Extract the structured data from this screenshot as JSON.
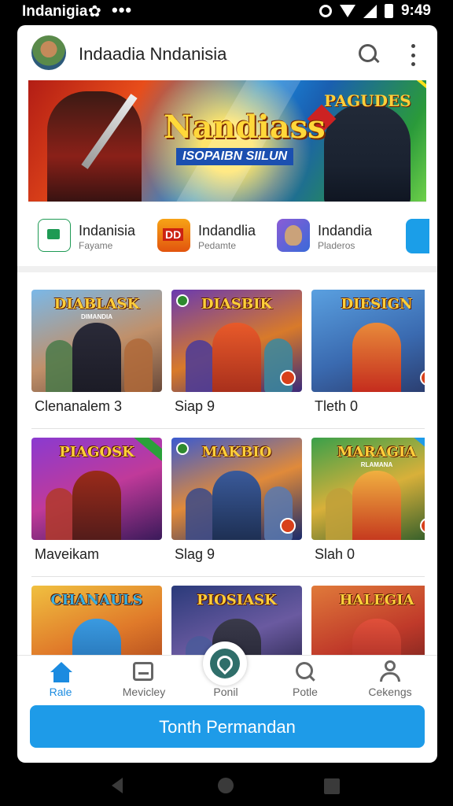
{
  "status_bar": {
    "title": "Indanigia",
    "time": "9:49"
  },
  "app_bar": {
    "title": "Indaadia Nndanisia"
  },
  "banner": {
    "headline": "Nandiass",
    "subtitle": "ISOPAIBN SIILUN",
    "right_logo": "PAGUDES"
  },
  "featured": [
    {
      "name": "Indanisia",
      "sub": "Fayame"
    },
    {
      "name": "Indandlia",
      "sub": "Pedamte"
    },
    {
      "name": "Indandia",
      "sub": "Pladeros"
    }
  ],
  "games": [
    {
      "caption": "Clenanalem 3",
      "logo": "DIABLASK",
      "tag": "DIMANDIA"
    },
    {
      "caption": "Siap 9",
      "logo": "DIASBIK",
      "tag": ""
    },
    {
      "caption": "Tleth 0",
      "logo": "DIESIGN",
      "tag": ""
    },
    {
      "caption": "Maveikam",
      "logo": "PIAGOSK",
      "tag": ""
    },
    {
      "caption": "Slag 9",
      "logo": "MAKBIO",
      "tag": ""
    },
    {
      "caption": "Slah 0",
      "logo": "MARAGIA",
      "tag": "RLAMANA"
    },
    {
      "caption": "",
      "logo": "CHANAULS",
      "tag": ""
    },
    {
      "caption": "",
      "logo": "PIOSIASK",
      "tag": ""
    },
    {
      "caption": "",
      "logo": "HALEGIA",
      "tag": ""
    }
  ],
  "bottom_nav": [
    {
      "label": "Rale",
      "icon": "home-icon",
      "active": true
    },
    {
      "label": "Mevicley",
      "icon": "library-icon",
      "active": false
    },
    {
      "label": "Ponil",
      "icon": "center-app-icon",
      "active": false
    },
    {
      "label": "Potle",
      "icon": "search-icon",
      "active": false
    },
    {
      "label": "Cekengs",
      "icon": "user-icon",
      "active": false
    }
  ],
  "cta": {
    "label": "Tonth Permandan"
  },
  "colors": {
    "accent": "#1e9be8",
    "nav_active": "#1b8be0"
  }
}
